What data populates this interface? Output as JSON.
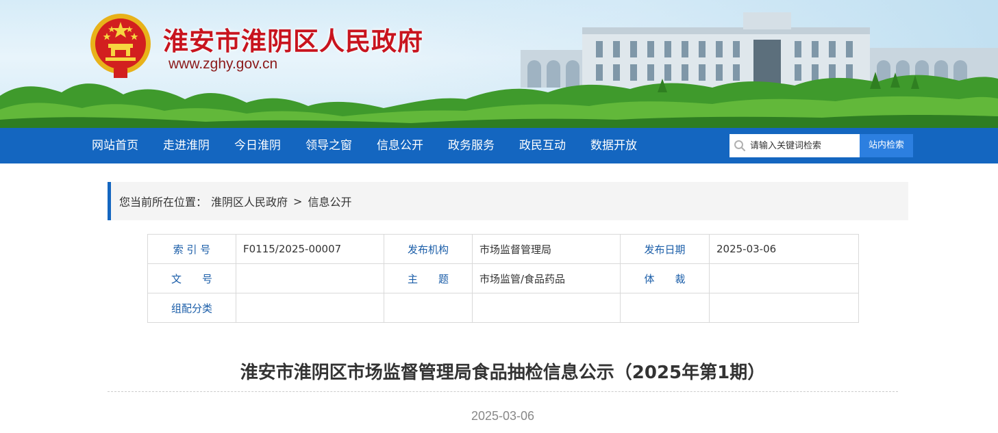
{
  "header": {
    "site_title": "淮安市淮阴区人民政府",
    "site_url": "www.zghy.gov.cn",
    "title_color": "#c8141e",
    "emblem_icon": "national-emblem-icon"
  },
  "nav": {
    "items": [
      {
        "label": "网站首页"
      },
      {
        "label": "走进淮阴"
      },
      {
        "label": "今日淮阴"
      },
      {
        "label": "领导之窗"
      },
      {
        "label": "信息公开"
      },
      {
        "label": "政务服务"
      },
      {
        "label": "政民互动"
      },
      {
        "label": "数据开放"
      }
    ],
    "bar_color": "#1466c0"
  },
  "search": {
    "placeholder": "请输入关键词检索",
    "button_label": "站内检索",
    "icon": "search-icon"
  },
  "breadcrumb": {
    "prefix": "您当前所在位置：",
    "items": [
      "淮阴区人民政府",
      "信息公开"
    ],
    "separator": ">"
  },
  "info_table": {
    "rows": [
      [
        {
          "label": "索 引 号",
          "value": "F0115/2025-00007"
        },
        {
          "label": "发布机构",
          "value": "市场监督管理局"
        },
        {
          "label": "发布日期",
          "value": "2025-03-06"
        }
      ],
      [
        {
          "label": "文　　号",
          "value": ""
        },
        {
          "label": "主　　题",
          "value": "市场监管/食品药品"
        },
        {
          "label": "体　　裁",
          "value": ""
        }
      ],
      [
        {
          "label": "组配分类",
          "value": ""
        },
        {
          "label": "",
          "value": ""
        },
        {
          "label": "",
          "value": ""
        }
      ]
    ]
  },
  "article": {
    "title": "淮安市淮阴区市场监督管理局食品抽检信息公示（2025年第1期）",
    "date": "2025-03-06"
  }
}
